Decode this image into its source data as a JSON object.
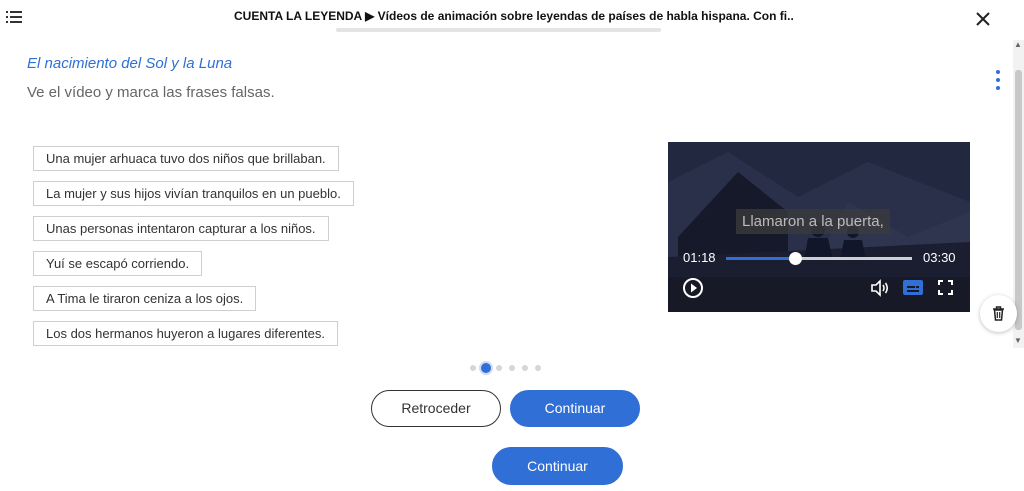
{
  "header": {
    "title": "CUENTA LA LEYENDA ▶ Vídeos de animación sobre leyendas de países de habla hispana. Con fi..."
  },
  "activity": {
    "title": "El nacimiento del Sol y la Luna",
    "instruction": "Ve el vídeo y marca las frases falsas.",
    "statements": [
      "Una mujer arhuaca tuvo dos niños que brillaban.",
      "La mujer y sus hijos vivían tranquilos en un pueblo.",
      "Unas personas intentaron capturar a los niños.",
      "Yuí se escapó corriendo.",
      "A Tima le tiraron ceniza a los ojos.",
      "Los dos hermanos huyeron a lugares diferentes."
    ]
  },
  "video": {
    "subtitle": "Llamaron a la puerta,",
    "current_time": "01:18",
    "total_time": "03:30",
    "progress_fraction": 0.371
  },
  "pager": {
    "total_pages": 6,
    "active_index": 1
  },
  "buttons": {
    "back_label": "Retroceder",
    "continue_label": "Continuar",
    "continue_bottom_label": "Continuar"
  },
  "colors": {
    "accent": "#2f6fd6"
  },
  "icons": {
    "menu": "hamburger-menu-icon",
    "close": "close-icon",
    "more": "vertical-dots-icon",
    "play": "play-icon",
    "volume": "volume-icon",
    "subtitles": "subtitles-icon",
    "fullscreen": "fullscreen-icon",
    "trash": "trash-icon"
  }
}
